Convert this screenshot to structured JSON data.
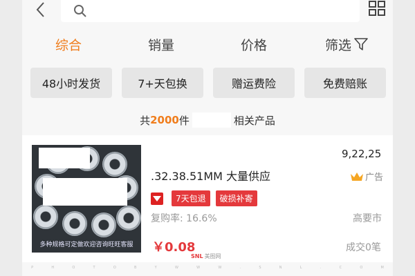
{
  "search": {
    "placeholder": ""
  },
  "sort_tabs": [
    {
      "label": "综合",
      "active": true
    },
    {
      "label": "销量",
      "active": false
    },
    {
      "label": "价格",
      "active": false
    },
    {
      "label": "筛选",
      "active": false
    }
  ],
  "filter_chips": [
    "48小时发货",
    "7+天包换",
    "赠运费险",
    "免费赔账"
  ],
  "result": {
    "prefix": "共",
    "count": "2000",
    "unit": "件",
    "suffix": "相关产品"
  },
  "product": {
    "price_top": "9,22,25",
    "title": ".32.38.51MM 大量供应",
    "ad_label": "广告",
    "tags": [
      "7天包退",
      "破损补寄"
    ],
    "repurchase": "复购率: 16.6%",
    "location": "高要市",
    "price": "￥0.08",
    "sales": "成交0笔",
    "image_caption": "多种规格可定做欢迎咨询旺旺客服"
  },
  "watermark": {
    "letters": [
      "P",
      "H",
      "O",
      "T",
      "O",
      "B",
      "Y",
      "W",
      "W",
      "W",
      ".",
      "S",
      "N",
      "L",
      ".",
      "C",
      "O",
      "M"
    ],
    "brand": "SNL",
    "brand_sub": "美图网"
  },
  "colors": {
    "accent": "#f07d1c",
    "tag_red": "#e4393c",
    "price_red": "#e4393c",
    "background": "#f7f7f7"
  },
  "icons": [
    "back-arrow-icon",
    "search-icon",
    "grid-view-icon",
    "filter-icon",
    "crown-icon",
    "tmall-icon"
  ]
}
